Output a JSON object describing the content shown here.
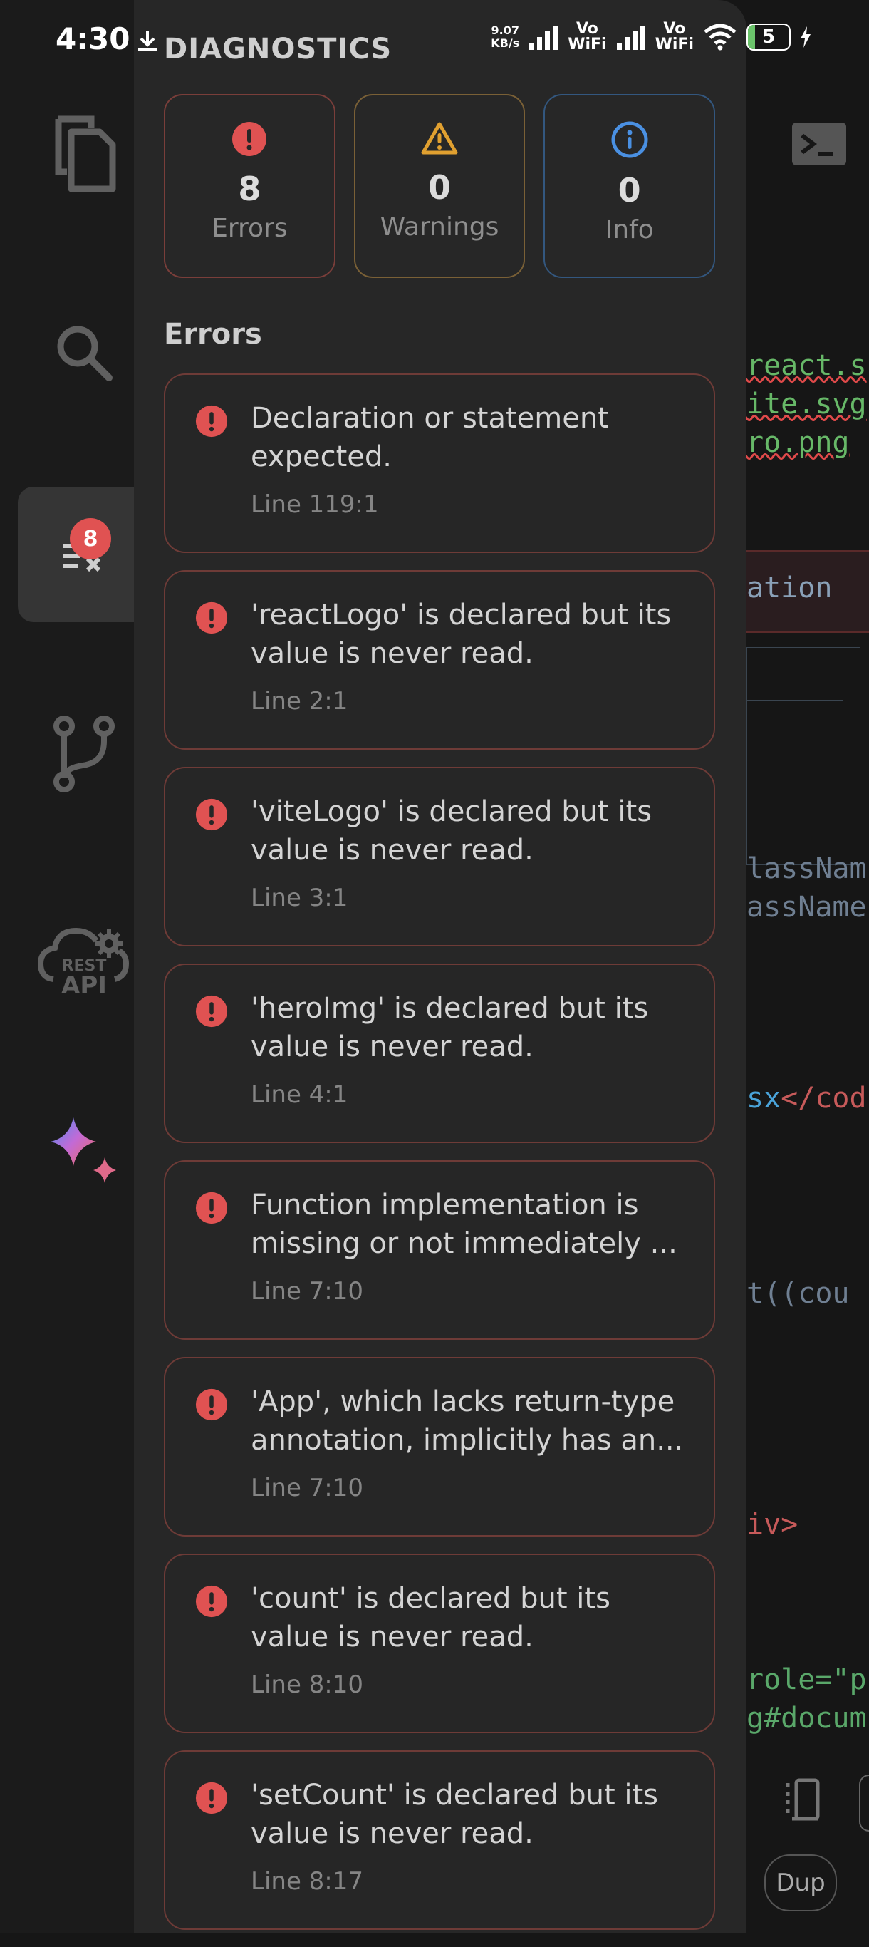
{
  "status_bar": {
    "time": "4:30",
    "net_speed_value": "9.07",
    "net_speed_unit": "KB/s",
    "vowifi_1_top": "Vo",
    "vowifi_1_bottom": "WiFi",
    "vowifi_2_top": "Vo",
    "vowifi_2_bottom": "WiFi",
    "battery_level": "5"
  },
  "sidebar": {
    "items": [
      {
        "icon": "files-icon"
      },
      {
        "icon": "search-icon"
      },
      {
        "icon": "diagnostics-icon",
        "badge": "8",
        "active": true
      },
      {
        "icon": "git-branch-icon"
      },
      {
        "icon": "rest-api-icon",
        "label_top": "REST",
        "label_bottom": "API"
      },
      {
        "icon": "ai-sparkle-icon"
      }
    ]
  },
  "drawer": {
    "title": "DIAGNOSTICS",
    "summary": {
      "errors": {
        "count": "8",
        "label": "Errors",
        "color": "#e05252"
      },
      "warnings": {
        "count": "0",
        "label": "Warnings",
        "color": "#e0a030"
      },
      "info": {
        "count": "0",
        "label": "Info",
        "color": "#4a90e2"
      }
    },
    "section_title": "Errors",
    "errors": [
      {
        "message": "Declaration or statement expected.",
        "location": "Line 119:1"
      },
      {
        "message": "'reactLogo' is declared but its value is never read.",
        "location": "Line 2:1"
      },
      {
        "message": "'viteLogo' is declared but its value is never read.",
        "location": "Line 3:1"
      },
      {
        "message": "'heroImg' is declared but its value is never read.",
        "location": "Line 4:1"
      },
      {
        "message": "Function implementation is missing or not immediately ...",
        "location": "Line 7:10"
      },
      {
        "message": "'App', which lacks return-type annotation, implicitly has an...",
        "location": "Line 7:10"
      },
      {
        "message": "'count' is declared but its value is never read.",
        "location": "Line 8:10"
      },
      {
        "message": "'setCount' is declared but its value is never read.",
        "location": "Line 8:17"
      }
    ]
  },
  "editor_background": {
    "lines": [
      {
        "text": "react.s",
        "color": "#67b868"
      },
      {
        "text": "ite.svg",
        "color": "#67b868"
      },
      {
        "text": "ro.png",
        "color": "#67b868"
      },
      {
        "text": "ation",
        "color": "#8aa1b8"
      },
      {
        "text": "lassNam",
        "color": "#6f7f92"
      },
      {
        "text": "assName",
        "color": "#6f7f92"
      },
      {
        "text": "sx",
        "color": "#4aa3d9"
      },
      {
        "text": "</cod",
        "color": "#c75a5a"
      },
      {
        "text": "t((cou",
        "color": "#6f7f92"
      },
      {
        "text": "iv>",
        "color": "#c75a5a"
      },
      {
        "text": "role=\"p",
        "color": "#5aa86a"
      },
      {
        "text": "g#docum",
        "color": "#5aa86a"
      }
    ],
    "dup_button": "Dup"
  }
}
